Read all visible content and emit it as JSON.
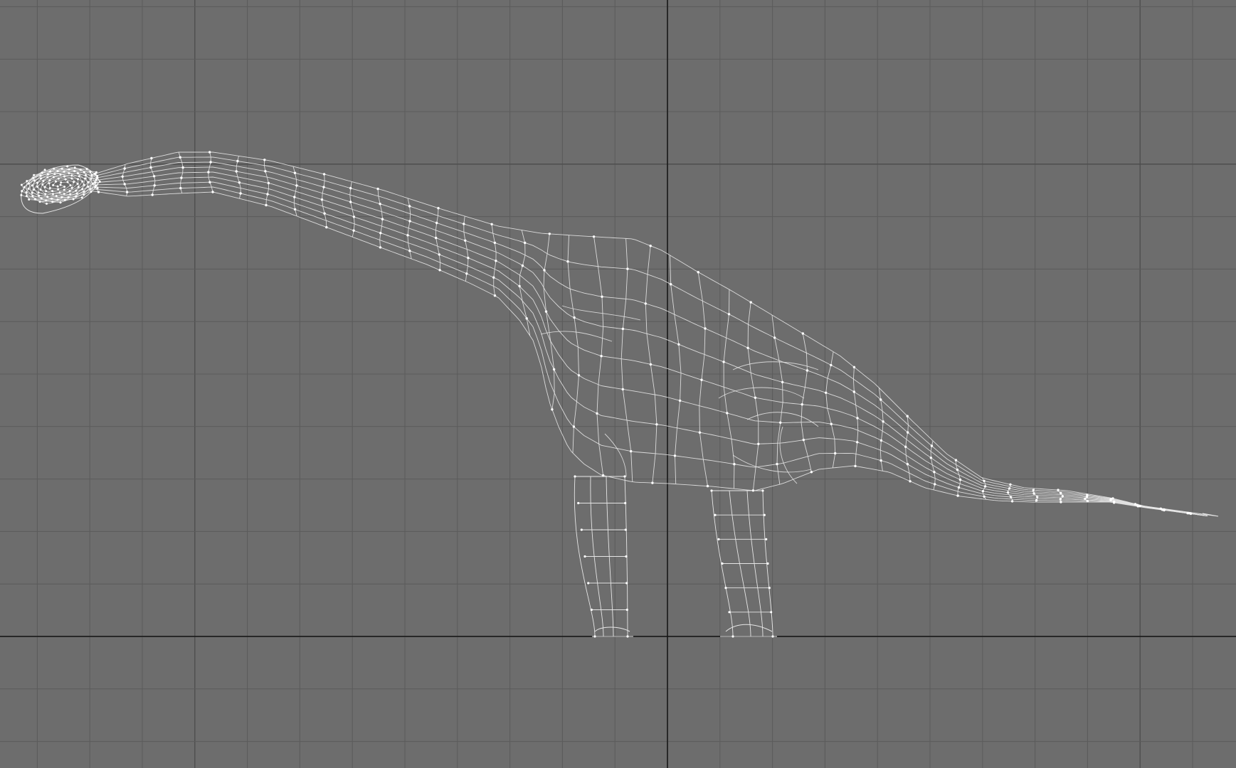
{
  "viewport": {
    "view": "side-orthographic",
    "mode": "wireframe",
    "object": "brachiosaurus-mesh"
  },
  "colors": {
    "background": "#6d6d6d",
    "grid_minor": "#5b5b5b",
    "grid_major": "#4b4b4b",
    "axis": "#151515",
    "wire": "#e6e6e6",
    "vertex": "#ffffff"
  }
}
